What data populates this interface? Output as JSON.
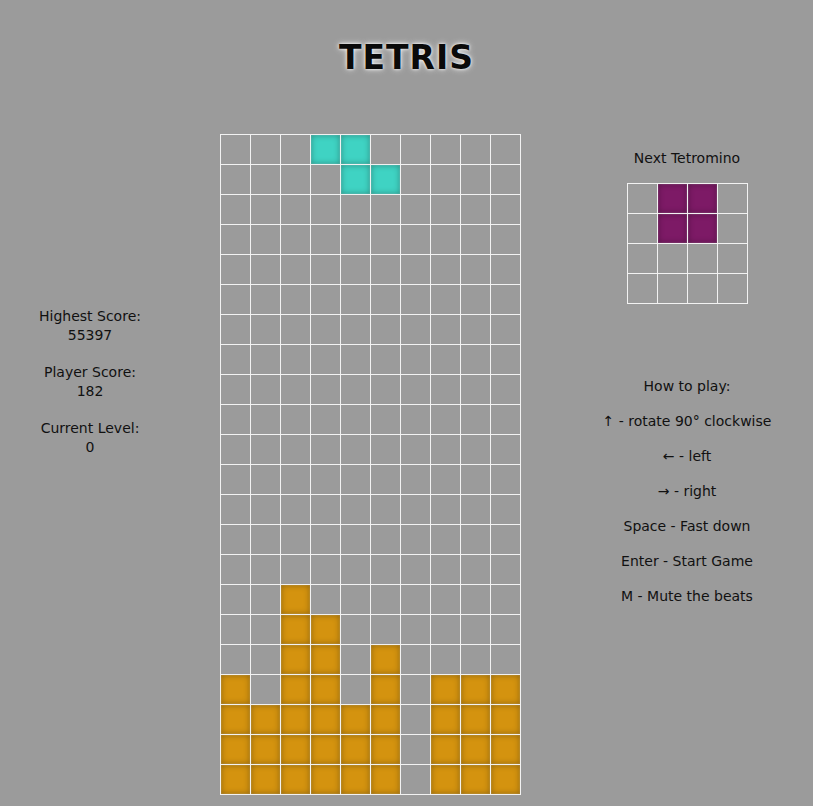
{
  "window": {
    "title": "TETRIS"
  },
  "stats": [
    {
      "label": "Highest Score:",
      "value": "55397"
    },
    {
      "label": "Player Score:",
      "value": "182"
    },
    {
      "label": "Current Level:",
      "value": "0"
    }
  ],
  "board": {
    "rows": 22,
    "columns": 10,
    "pieces": [
      {
        "kind": "active",
        "color": "#3fd3c3",
        "cells": [
          [
            0,
            3
          ],
          [
            0,
            4
          ],
          [
            1,
            4
          ],
          [
            1,
            5
          ]
        ]
      },
      {
        "kind": "locked",
        "color": "#d4930f",
        "cells": [
          [
            15,
            2
          ],
          [
            16,
            2
          ],
          [
            16,
            3
          ],
          [
            17,
            2
          ],
          [
            17,
            3
          ],
          [
            17,
            5
          ],
          [
            18,
            0
          ],
          [
            18,
            2
          ],
          [
            18,
            3
          ],
          [
            18,
            5
          ],
          [
            18,
            7
          ],
          [
            18,
            8
          ],
          [
            18,
            9
          ],
          [
            19,
            0
          ],
          [
            19,
            1
          ],
          [
            19,
            2
          ],
          [
            19,
            3
          ],
          [
            19,
            4
          ],
          [
            19,
            5
          ],
          [
            19,
            7
          ],
          [
            19,
            8
          ],
          [
            19,
            9
          ],
          [
            20,
            0
          ],
          [
            20,
            1
          ],
          [
            20,
            2
          ],
          [
            20,
            3
          ],
          [
            20,
            4
          ],
          [
            20,
            5
          ],
          [
            20,
            7
          ],
          [
            20,
            8
          ],
          [
            20,
            9
          ],
          [
            21,
            0
          ],
          [
            21,
            1
          ],
          [
            21,
            2
          ],
          [
            21,
            3
          ],
          [
            21,
            4
          ],
          [
            21,
            5
          ],
          [
            21,
            7
          ],
          [
            21,
            8
          ],
          [
            21,
            9
          ]
        ]
      }
    ]
  },
  "next": {
    "label": "Next Tetromino",
    "rows": 4,
    "columns": 4,
    "color": "#7d1a66",
    "cells": [
      [
        0,
        1
      ],
      [
        0,
        2
      ],
      [
        1,
        1
      ],
      [
        1,
        2
      ]
    ]
  },
  "help": {
    "title": "How to play:",
    "controls": [
      "↑ - rotate 90° clockwise",
      "← - left",
      "→ - right",
      "Space - Fast down",
      "Enter - Start Game",
      "M - Mute the beats"
    ]
  }
}
